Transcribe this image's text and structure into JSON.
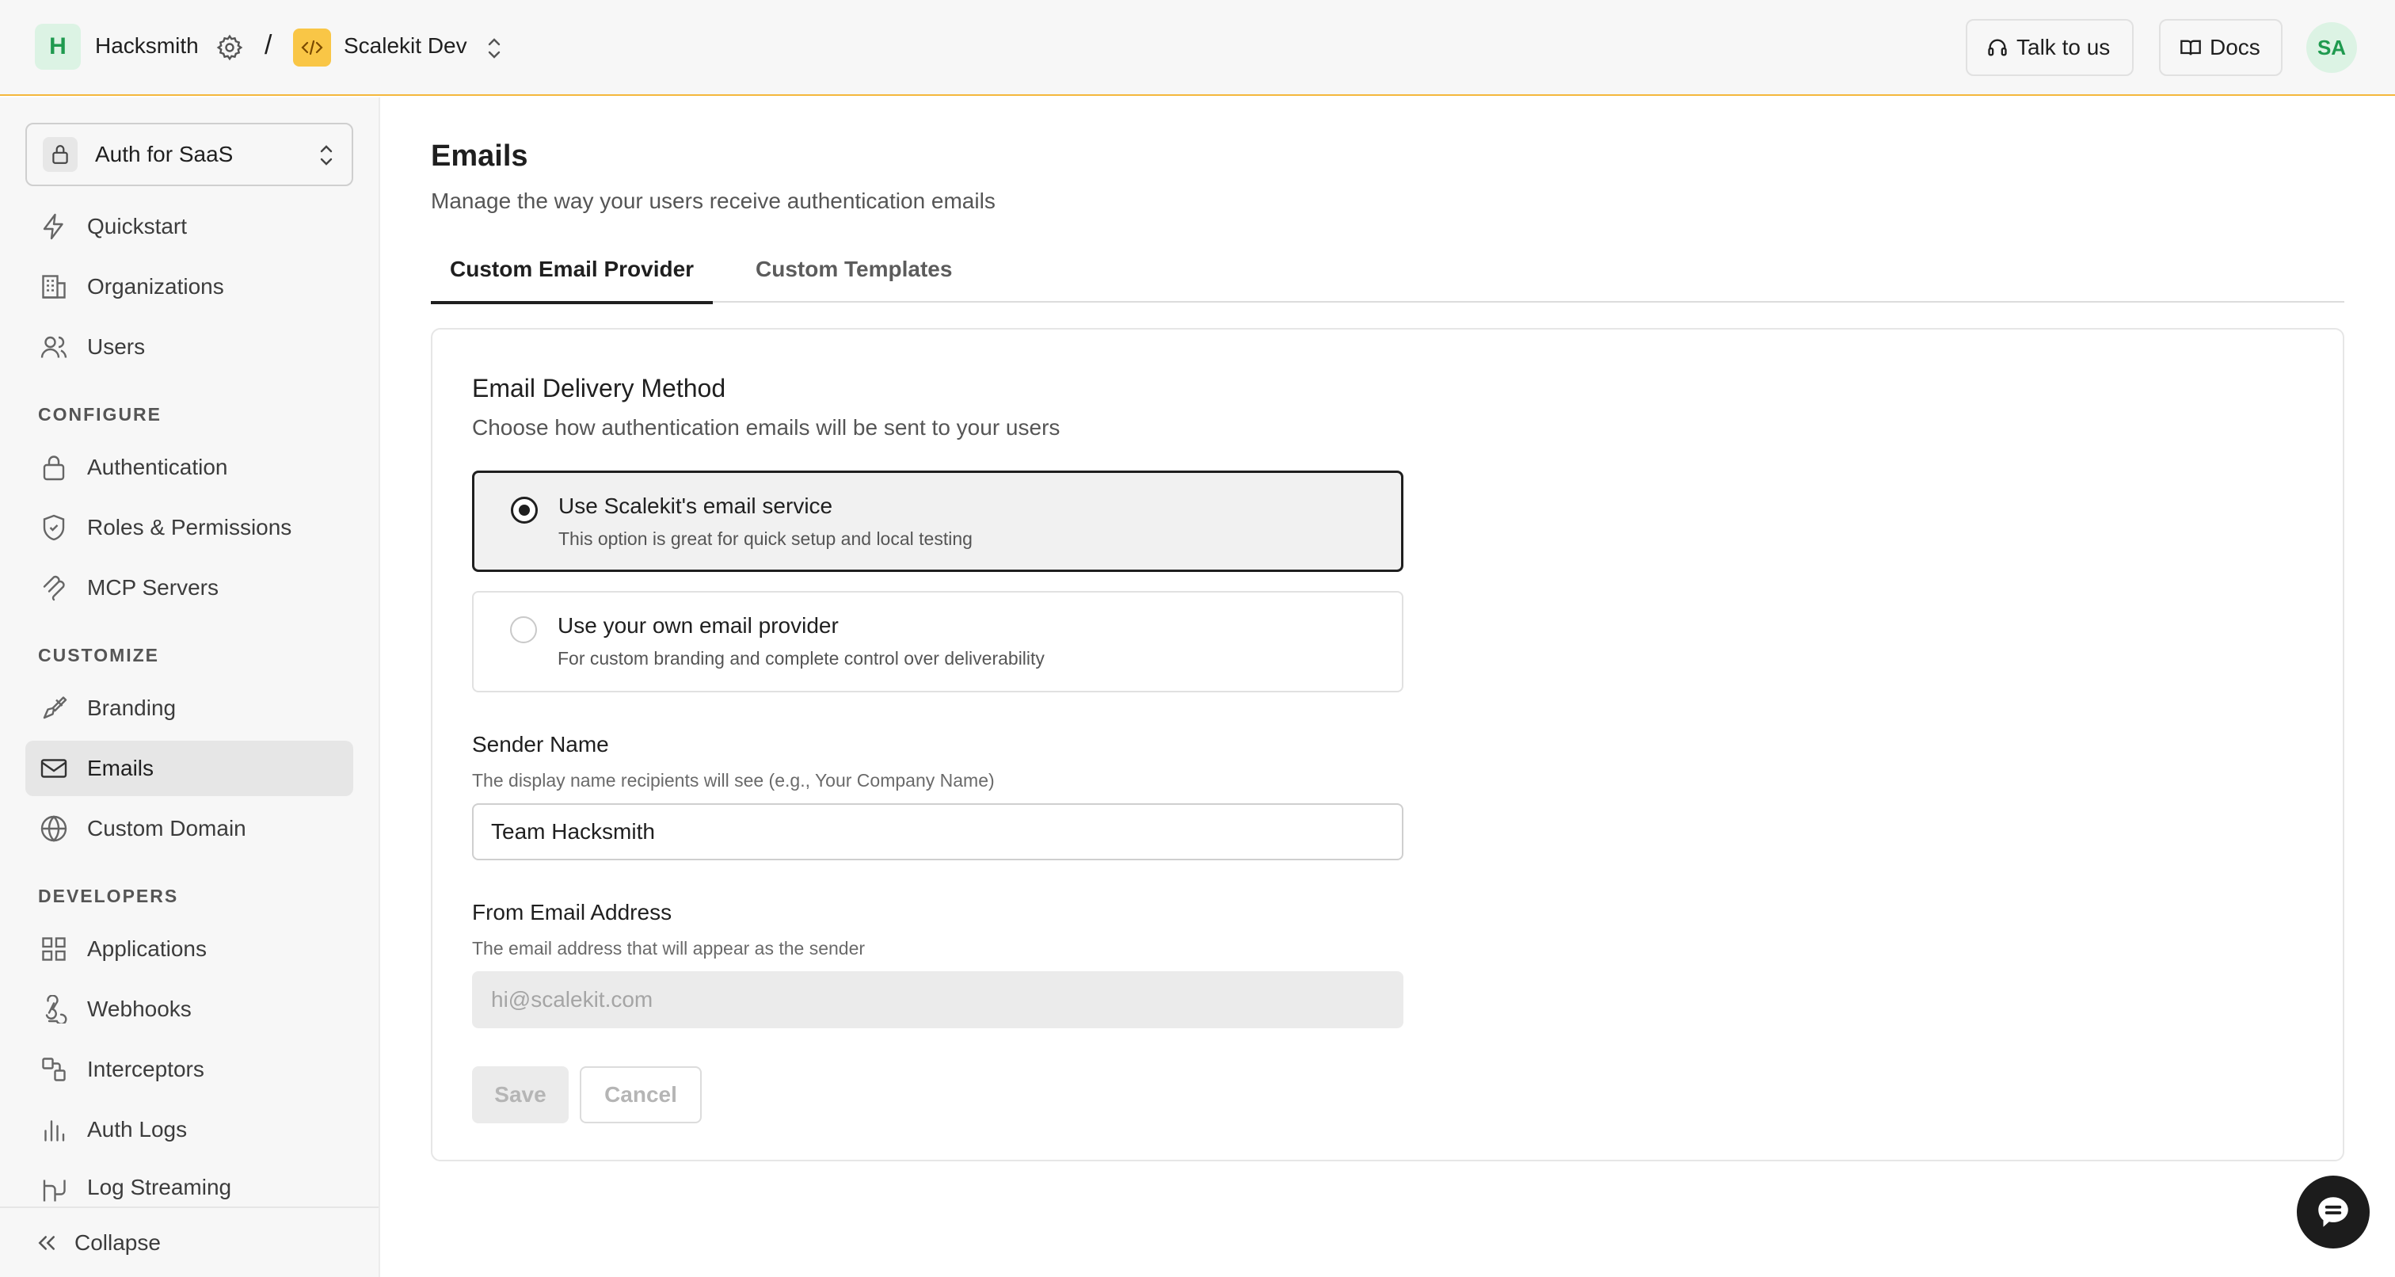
{
  "topbar": {
    "org_initial": "H",
    "org_name": "Hacksmith",
    "separator": "/",
    "env_name": "Scalekit Dev",
    "talk_label": "Talk to us",
    "docs_label": "Docs",
    "user_initials": "SA"
  },
  "sidebar": {
    "project": "Auth for SaaS",
    "top_items": [
      {
        "label": "Quickstart",
        "icon": "bolt-icon"
      },
      {
        "label": "Organizations",
        "icon": "building-icon"
      },
      {
        "label": "Users",
        "icon": "users-icon"
      }
    ],
    "sections": [
      {
        "label": "CONFIGURE",
        "items": [
          {
            "label": "Authentication",
            "icon": "lock-icon"
          },
          {
            "label": "Roles & Permissions",
            "icon": "shield-icon"
          },
          {
            "label": "MCP Servers",
            "icon": "mcp-icon"
          }
        ]
      },
      {
        "label": "CUSTOMIZE",
        "items": [
          {
            "label": "Branding",
            "icon": "brush-icon"
          },
          {
            "label": "Emails",
            "icon": "mail-icon",
            "active": true
          },
          {
            "label": "Custom Domain",
            "icon": "globe-icon"
          }
        ]
      },
      {
        "label": "DEVELOPERS",
        "items": [
          {
            "label": "Applications",
            "icon": "grid-icon"
          },
          {
            "label": "Webhooks",
            "icon": "webhook-icon"
          },
          {
            "label": "Interceptors",
            "icon": "interceptor-icon"
          },
          {
            "label": "Auth Logs",
            "icon": "bar-chart-icon"
          },
          {
            "label": "Log Streaming",
            "icon": "stream-icon"
          }
        ]
      }
    ],
    "collapse_label": "Collapse"
  },
  "main": {
    "title": "Emails",
    "subtitle": "Manage the way your users receive authentication emails",
    "tabs": [
      {
        "label": "Custom Email Provider",
        "active": true
      },
      {
        "label": "Custom Templates",
        "active": false
      }
    ],
    "card": {
      "title": "Email Delivery Method",
      "subtitle": "Choose how authentication emails will be sent to your users",
      "options": [
        {
          "title": "Use Scalekit's email service",
          "desc": "This option is great for quick setup and local testing",
          "selected": true
        },
        {
          "title": "Use your own email provider",
          "desc": "For custom branding and complete control over deliverability",
          "selected": false
        }
      ],
      "sender": {
        "label": "Sender Name",
        "help": "The display name recipients will see (e.g., Your Company Name)",
        "value": "Team Hacksmith"
      },
      "from": {
        "label": "From Email Address",
        "help": "The email address that will appear as the sender",
        "placeholder": "hi@scalekit.com",
        "value": ""
      },
      "save_label": "Save",
      "cancel_label": "Cancel"
    }
  },
  "colors": {
    "accent_border": "#f4b73c",
    "org_badge_bg": "#dcf3e4",
    "org_badge_fg": "#1f9a4f",
    "env_badge_bg": "#f9c646"
  }
}
